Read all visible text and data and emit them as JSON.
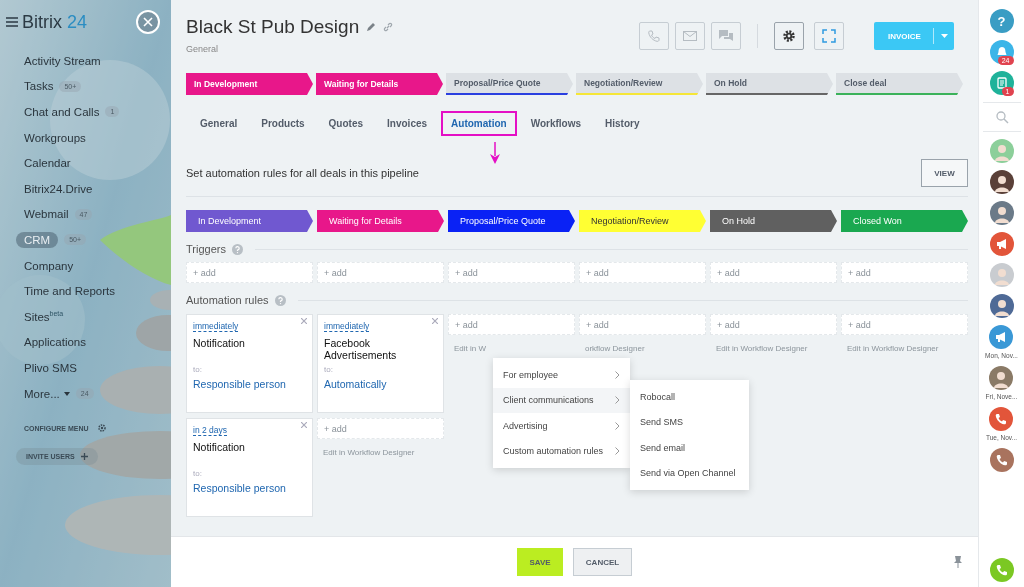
{
  "sidebar": {
    "logo": {
      "name": "Bitrix",
      "number": "24"
    },
    "items": [
      {
        "label": "Activity Stream",
        "selected": false
      },
      {
        "label": "Tasks",
        "badge": "50+",
        "selected": false
      },
      {
        "label": "Chat and Calls",
        "badge": "1",
        "selected": false
      },
      {
        "label": "Workgroups",
        "selected": false
      },
      {
        "label": "Calendar",
        "selected": false
      },
      {
        "label": "Bitrix24.Drive",
        "selected": false
      },
      {
        "label": "Webmail",
        "badge": "47",
        "selected": false
      },
      {
        "label": "CRM",
        "badge": "50+",
        "selected": true
      },
      {
        "label": "Company",
        "selected": false
      },
      {
        "label": "Time and Reports",
        "selected": false
      },
      {
        "label": "Sites$^{beta}$",
        "selected": false
      },
      {
        "label": "Applications",
        "selected": false
      },
      {
        "label": "Plivo SMS",
        "selected": false
      },
      {
        "label": "More...",
        "badge": "24",
        "selected": false,
        "dropdown": true
      }
    ],
    "configure": "CONFIGURE MENU",
    "invite": "INVITE USERS"
  },
  "deal": {
    "title": "Black St Pub Design",
    "subtitle": "General",
    "primary_button": "INVOICE"
  },
  "deal_stages": [
    {
      "label": "In Development",
      "color": "#e8178a",
      "reached": true
    },
    {
      "label": "Waiting for Details",
      "color": "#e8178a",
      "reached": true
    },
    {
      "label": "Proposal/Price Quote",
      "color": "#2a3fe0",
      "reached": false
    },
    {
      "label": "Negotiation/Review",
      "color": "#f5e637",
      "reached": false
    },
    {
      "label": "On Hold",
      "color": "#666666",
      "reached": false
    },
    {
      "label": "Close deal",
      "color": "#3bb25a",
      "reached": false
    }
  ],
  "tabs": [
    {
      "label": "General",
      "selected": false
    },
    {
      "label": "Products",
      "selected": false
    },
    {
      "label": "Quotes",
      "selected": false
    },
    {
      "label": "Invoices",
      "selected": false
    },
    {
      "label": "Automation",
      "selected": true
    },
    {
      "label": "Workflows",
      "selected": false
    },
    {
      "label": "History",
      "selected": false
    }
  ],
  "automation": {
    "intro": "Set automation rules for all deals in this pipeline",
    "view_button": "VIEW",
    "stages": [
      {
        "label": "In Development",
        "color": "#7058d0"
      },
      {
        "label": "Waiting for Details",
        "color": "#e8178a"
      },
      {
        "label": "Proposal/Price Quote",
        "color": "#0a22f5"
      },
      {
        "label": "Negotiation/Review",
        "color": "#ffff33"
      },
      {
        "label": "On Hold",
        "color": "#606060"
      },
      {
        "label": "Closed Won",
        "color": "#1aa850"
      }
    ],
    "triggers_label": "Triggers",
    "rules_label": "Automation rules",
    "trigger_cells": [
      "+ add",
      "+ add",
      "+ add",
      "+ add",
      "+ add",
      "+ add"
    ],
    "columns": [
      {
        "rules": [
          {
            "timing": "immediately",
            "title": "Notification",
            "to_label": "to:",
            "recipient": "Responsible person"
          },
          {
            "timing": "in 2 days",
            "title": "Notification",
            "to_label": "to:",
            "recipient": "Responsible person"
          }
        ]
      },
      {
        "rules": [
          {
            "timing": "immediately",
            "title": "Facebook Advertisements",
            "to_label": "to:",
            "recipient": "Automatically"
          }
        ],
        "add": "+ add",
        "hint": "Edit in Workflow Designer"
      },
      {
        "add": "+ add",
        "hint": "Edit in W"
      },
      {
        "add": "+ add",
        "hint": "orkflow Designer"
      },
      {
        "add": "+ add",
        "hint": "Edit in Workflow Designer"
      },
      {
        "add": "+ add",
        "hint": "Edit in Workflow Designer"
      }
    ]
  },
  "menu": {
    "items": [
      {
        "label": "For employee",
        "selected": false
      },
      {
        "label": "Client communications",
        "selected": true
      },
      {
        "label": "Advertising",
        "selected": false
      },
      {
        "label": "Custom automation rules",
        "selected": false
      }
    ],
    "submenu": [
      "Robocall",
      "Send SMS",
      "Send email",
      "Send via Open Channel"
    ]
  },
  "footer": {
    "save": "SAVE",
    "cancel": "CANCEL"
  },
  "right_bar": {
    "items": [
      {
        "kind": "help",
        "color": "#3a9dc4",
        "glyph": "?"
      },
      {
        "kind": "bell",
        "color": "#3bb5e8",
        "badge": "24"
      },
      {
        "kind": "chat",
        "color": "#1fb29a",
        "badge": "1"
      },
      {
        "kind": "search"
      },
      {
        "kind": "avatar",
        "color": "#8ccf9a"
      },
      {
        "kind": "avatar",
        "color": "#5a4038"
      },
      {
        "kind": "avatar",
        "color": "#6b7a88"
      },
      {
        "kind": "megaphone",
        "color": "#e2553a"
      },
      {
        "kind": "avatar",
        "color": "#c9ccd0"
      },
      {
        "kind": "avatar",
        "color": "#4f6a96"
      },
      {
        "kind": "megaphone",
        "color": "#3a98d6",
        "caption": "Mon, Nov..."
      },
      {
        "kind": "avatar",
        "color": "#8a7a66",
        "caption": "Fri, Nove..."
      },
      {
        "kind": "phone",
        "color": "#e2553a",
        "caption": "Tue, Nov..."
      },
      {
        "kind": "phone",
        "color": "#a9735e"
      },
      {
        "kind": "call",
        "color": "#7bc823"
      }
    ]
  }
}
